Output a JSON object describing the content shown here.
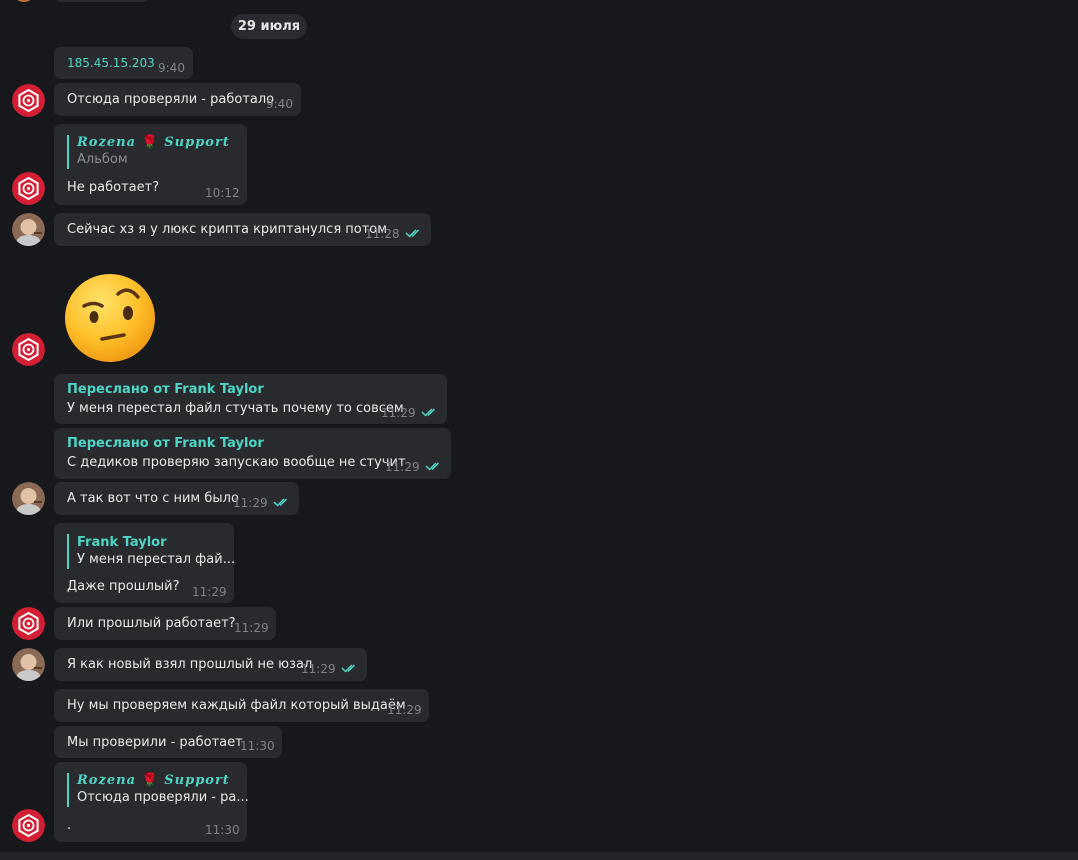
{
  "date_separator": "29 июля",
  "messages": [
    {
      "text": "185.45.15.203",
      "time": "9:40"
    },
    {
      "text": "Отсюда проверяли - работало",
      "time": "9:40"
    },
    {
      "quote_author": "Rozena 🌹 Support",
      "quote_text": "Альбом",
      "text": "Не работает?",
      "time": "10:12"
    },
    {
      "text": "Сейчас хз я у люкс крипта криптанулся потом",
      "time": "11:28"
    },
    {
      "sticker": "emoji-raised-eyebrow"
    },
    {
      "forwarded_from": "Переслано от Frank Taylor",
      "text": "У меня перестал файл стучать почему то совсем",
      "time": "11:29"
    },
    {
      "forwarded_from": "Переслано от Frank Taylor",
      "text": "С дедиков проверяю запускаю вообще не стучит",
      "time": "11:29"
    },
    {
      "text": "А так вот что с ним было",
      "time": "11:29"
    },
    {
      "quote_author": "Frank Taylor",
      "quote_text": "У меня перестал фай...",
      "text": "Даже прошлый?",
      "time": "11:29"
    },
    {
      "text": "Или прошлый работает?",
      "time": "11:29"
    },
    {
      "text": "Я как новый взял прошлый не юзал",
      "time": "11:29"
    },
    {
      "text": "Ну мы проверяем каждый файл который выдаём",
      "time": "11:29"
    },
    {
      "text": "Мы проверили - работает",
      "time": "11:30"
    },
    {
      "quote_author": "Rozena 🌹 Support",
      "quote_text": "Отсюда проверяли - ра...",
      "text": ".",
      "time": "11:30"
    }
  ],
  "quote_fancy": {
    "name_left": "Rozena",
    "rose": "🌹",
    "name_right": "Support"
  },
  "colors": {
    "background": "#17181c",
    "bubble": "#282a2e",
    "accent": "#4dd6c6",
    "support_avatar": "#d41e34",
    "time": "#7f8289"
  }
}
